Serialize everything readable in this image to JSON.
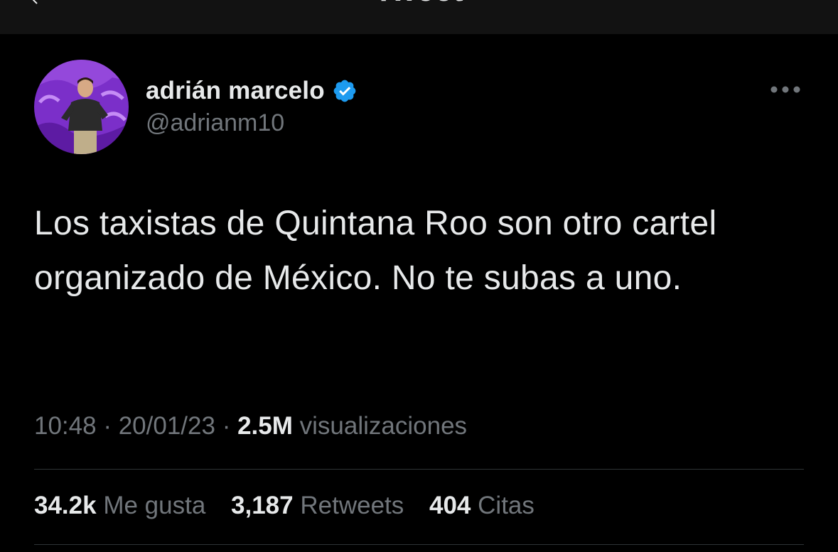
{
  "header": {
    "title": "Tweet"
  },
  "author": {
    "display_name": "adrián marcelo",
    "handle": "@adrianm10",
    "verified": true,
    "verified_color": "#1d9bf0"
  },
  "tweet": {
    "text": "Los taxistas de Quintana Roo son otro cartel organizado de México. No te subas a uno.",
    "time": "10:48",
    "separator": "·",
    "date": "20/01/23",
    "views_count": "2.5M",
    "views_label": "visualizaciones"
  },
  "stats": {
    "likes_count": "34.2k",
    "likes_label": "Me gusta",
    "retweets_count": "3,187",
    "retweets_label": "Retweets",
    "quotes_count": "404",
    "quotes_label": "Citas"
  },
  "icons": {
    "back": "arrow-left-icon",
    "verified": "verified-badge-icon",
    "more": "more-horizontal-icon"
  },
  "colors": {
    "background": "#000000",
    "text_primary": "#e7e9ea",
    "text_secondary": "#71767b",
    "divider": "#2f3336",
    "avatar_bg": "#7b2fc9"
  }
}
